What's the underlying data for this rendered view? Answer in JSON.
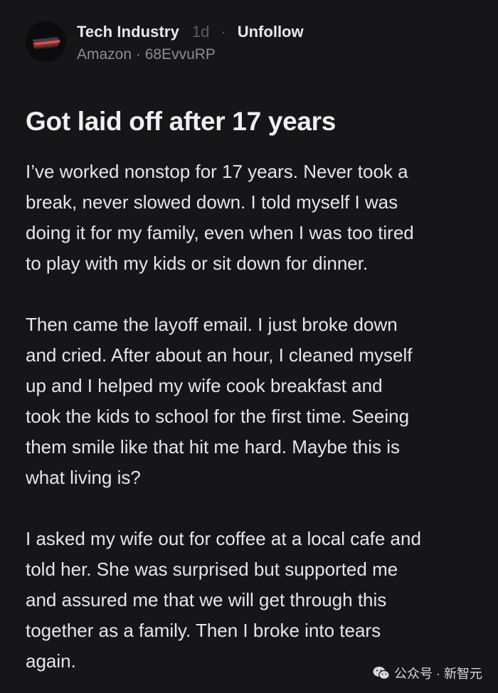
{
  "header": {
    "community": "Tech Industry",
    "age": "1d",
    "separator": "·",
    "unfollow_label": "Unfollow",
    "subline": "Amazon · 68EvvuRP"
  },
  "post": {
    "title": "Got laid off after 17 years",
    "lines": [
      "I’ve worked nonstop for 17 years. Never took a",
      "break, never slowed down. I told myself I was",
      "doing it for my family, even when I was too tired",
      "to play with my kids or sit down for dinner.",
      "Then came the layoff email. I just broke down",
      "and cried. After about an hour, I cleaned myself",
      "up and I helped my wife cook breakfast and",
      "took the kids to school for the first time. Seeing",
      "them smile like that hit me hard. Maybe this is",
      "what living is?",
      "I asked my wife out for coffee at a local cafe and",
      "told her. She was surprised but supported me",
      "and assured me that we will get through this",
      "together as a family. Then I broke into tears",
      "again."
    ]
  },
  "watermark": {
    "icon": "wechat-icon",
    "text": "公众号 · 新智元"
  }
}
